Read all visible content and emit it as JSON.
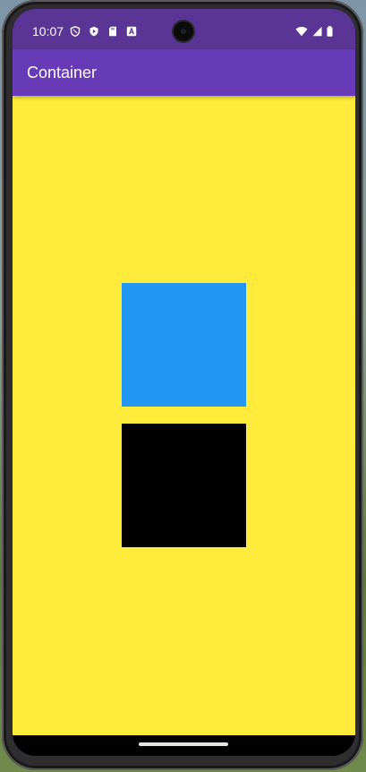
{
  "status_bar": {
    "time": "10:07",
    "left_icons": [
      "shield-icon",
      "play-protect-icon",
      "sd-card-icon",
      "a-badge-icon"
    ],
    "right_icons": [
      "wifi-icon",
      "signal-icon",
      "battery-icon"
    ]
  },
  "app_bar": {
    "title": "Container",
    "color": "#673ab7"
  },
  "content": {
    "background_color": "#ffeb3b",
    "boxes": [
      {
        "name": "blue-box",
        "color": "#2196f3"
      },
      {
        "name": "black-box",
        "color": "#000000"
      }
    ]
  },
  "nav_bar": {
    "handle": "home-gesture-handle"
  }
}
